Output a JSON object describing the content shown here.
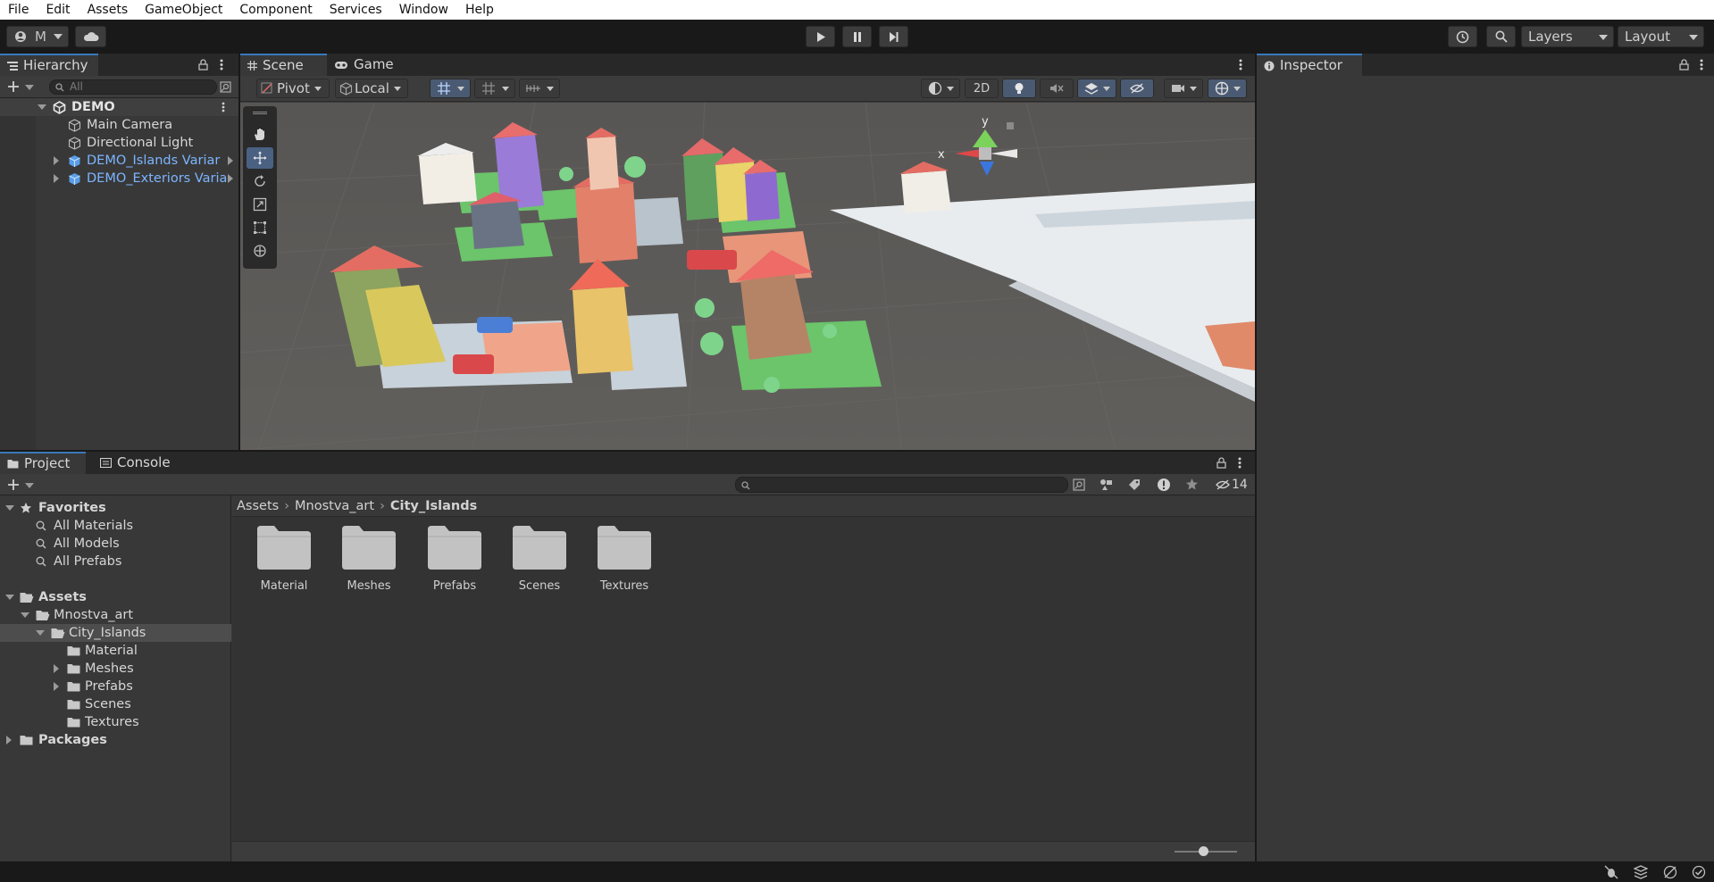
{
  "menu": [
    "File",
    "Edit",
    "Assets",
    "GameObject",
    "Component",
    "Services",
    "Window",
    "Help"
  ],
  "toolbar": {
    "account_label": "M",
    "layers_label": "Layers",
    "layout_label": "Layout"
  },
  "hierarchy": {
    "tab_label": "Hierarchy",
    "search_placeholder": "All",
    "scene_name": "DEMO",
    "items": [
      {
        "label": "Main Camera",
        "type": "gameobject"
      },
      {
        "label": "Directional Light",
        "type": "gameobject"
      },
      {
        "label": "DEMO_Islands Variar",
        "type": "prefab"
      },
      {
        "label": "DEMO_Exteriors Varia",
        "type": "prefab"
      }
    ]
  },
  "scene_view": {
    "tabs": [
      "Scene",
      "Game"
    ],
    "pivot_label": "Pivot",
    "local_label": "Local",
    "mode_2d_label": "2D",
    "gizmo_y_label": "y",
    "gizmo_x_label": "x"
  },
  "inspector": {
    "tab_label": "Inspector"
  },
  "project": {
    "tabs": [
      "Project",
      "Console"
    ],
    "favorites_label": "Favorites",
    "favorites": [
      "All Materials",
      "All Models",
      "All Prefabs"
    ],
    "assets_label": "Assets",
    "tree": {
      "mnostva": "Mnostva_art",
      "city_islands": "City_Islands",
      "children": [
        "Material",
        "Meshes",
        "Prefabs",
        "Scenes",
        "Textures"
      ]
    },
    "packages_label": "Packages",
    "breadcrumb": [
      "Assets",
      "Mnostva_art",
      "City_Islands"
    ],
    "folders": [
      "Material",
      "Meshes",
      "Prefabs",
      "Scenes",
      "Textures"
    ],
    "hidden_count": "14",
    "zoom_level": 0.45
  },
  "colors": {
    "accent": "#3a79bb",
    "panel": "#383838",
    "prefab_blue": "#7cb5ff"
  }
}
